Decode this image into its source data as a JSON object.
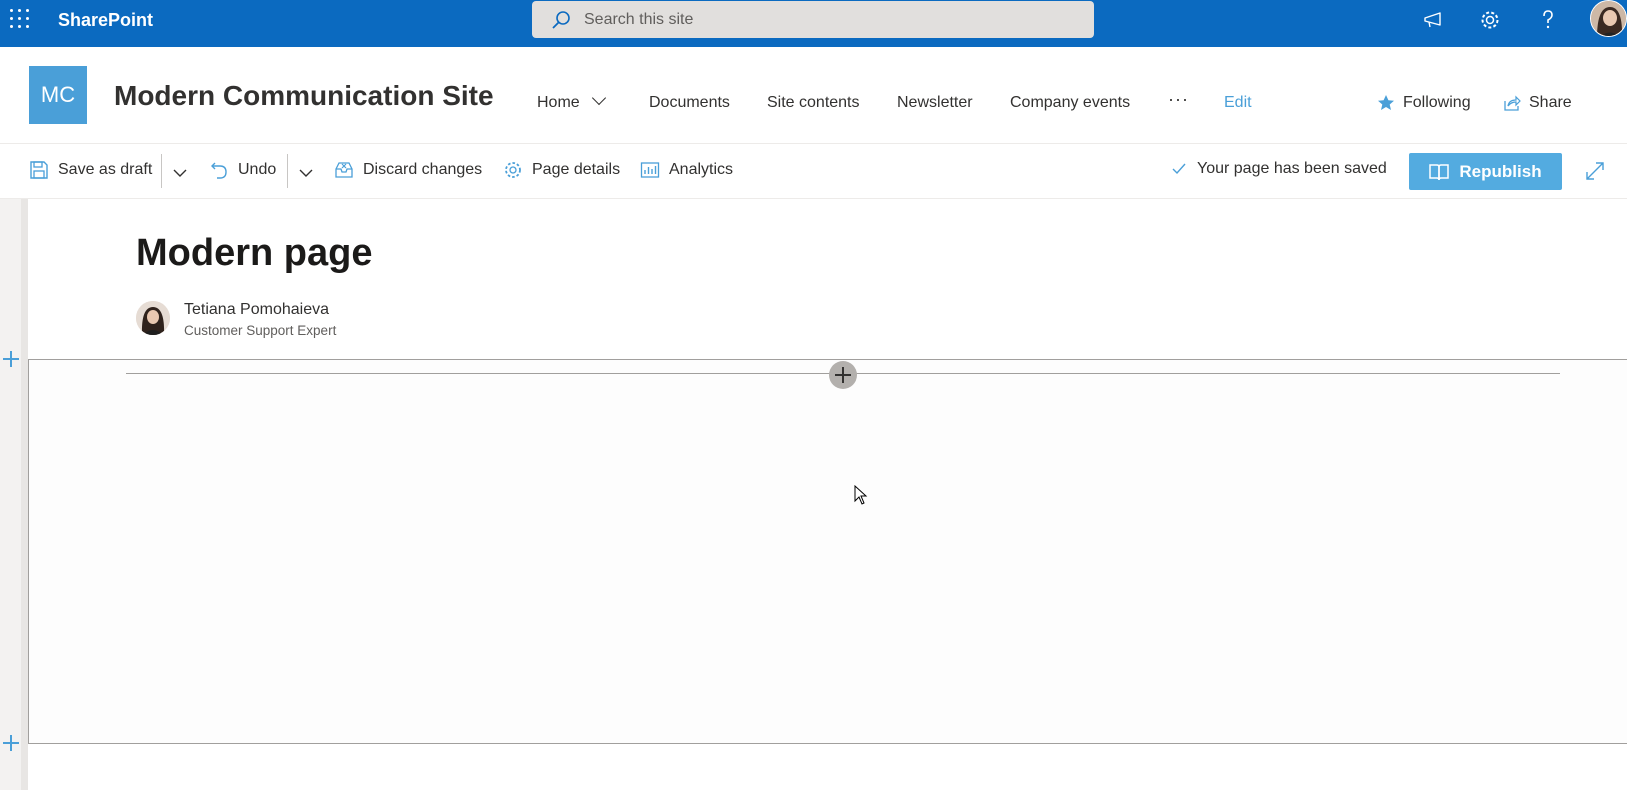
{
  "suite_bar": {
    "app_name": "SharePoint",
    "search_placeholder": "Search this site",
    "icons": [
      "waffle-icon",
      "megaphone-icon",
      "gear-icon",
      "help-icon",
      "user-avatar"
    ],
    "background": "#0b6ac0"
  },
  "site": {
    "logo_text": "MC",
    "logo_color": "#4a9fd8",
    "title": "Modern Communication Site",
    "nav": [
      {
        "label": "Home",
        "has_dropdown": true
      },
      {
        "label": "Documents"
      },
      {
        "label": "Site contents"
      },
      {
        "label": "Newsletter"
      },
      {
        "label": "Company events"
      },
      {
        "label": "···"
      },
      {
        "label": "Edit"
      }
    ],
    "following_label": "Following",
    "share_label": "Share"
  },
  "command_bar": {
    "save_draft_label": "Save as draft",
    "undo_label": "Undo",
    "discard_label": "Discard changes",
    "page_details_label": "Page details",
    "analytics_label": "Analytics",
    "saved_status": "Your page has been saved",
    "republish_label": "Republish"
  },
  "page": {
    "title": "Modern page",
    "author_name": "Tetiana Pomohaieva",
    "author_role": "Customer Support Expert"
  },
  "colors": {
    "accent": "#4a9fd8",
    "button": "#53abe0"
  }
}
